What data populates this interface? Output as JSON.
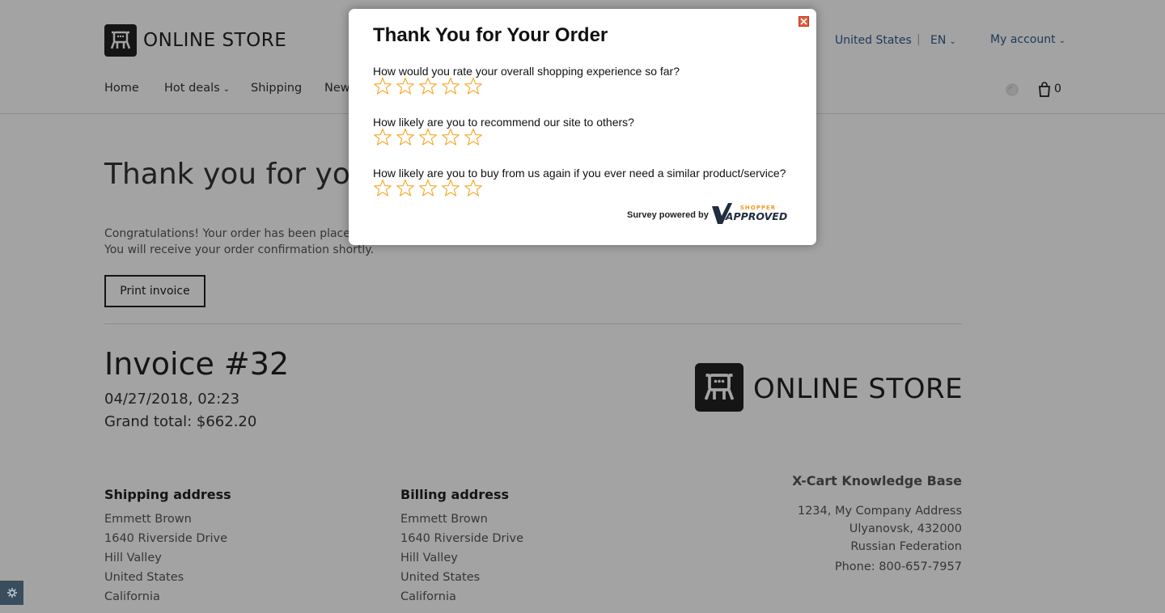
{
  "header": {
    "brand": "ONLINE STORE",
    "country": "United States",
    "separator": "|",
    "language": "EN",
    "account": "My account",
    "cart_count": "0",
    "nav": [
      "Home",
      "Hot deals",
      "Shipping",
      "New"
    ]
  },
  "page": {
    "heading": "Thank you for your order",
    "congrats_line1": "Congratulations! Your order has been placed.",
    "congrats_line2": "You will receive your order confirmation shortly.",
    "print_button": "Print invoice"
  },
  "invoice": {
    "title": "Invoice #32",
    "date": "04/27/2018, 02:23",
    "grand_total": "Grand total: $662.20",
    "brand": "ONLINE STORE",
    "shipping": {
      "title": "Shipping address",
      "lines": [
        "Emmett  Brown",
        "1640 Riverside Drive",
        "Hill Valley",
        "United States",
        "California"
      ]
    },
    "billing": {
      "title": "Billing address",
      "lines": [
        "Emmett  Brown",
        "1640 Riverside Drive",
        "Hill Valley",
        "United States",
        "California"
      ]
    },
    "company": {
      "name": "X-Cart Knowledge Base",
      "lines": [
        "1234, My Company Address",
        "Ulyanovsk, 432000",
        "Russian Federation",
        "Phone: 800-657-7957"
      ]
    }
  },
  "survey": {
    "title": "Thank You for Your Order",
    "questions": [
      {
        "text": "How would you rate your overall shopping experience so far?",
        "rating": 0,
        "max": 5
      },
      {
        "text": "How likely are you to recommend our site to others?",
        "rating": 0,
        "max": 5
      },
      {
        "text": "How likely are you to buy from us again if you ever need a similar product/service?",
        "rating": 0,
        "max": 5
      }
    ],
    "powered_by": "Survey powered by",
    "provider_logo_text": [
      "SHOPPER",
      "APPROVED"
    ]
  },
  "colors": {
    "link": "#2f5a8f",
    "star": "#f5a623",
    "close": "#e8583a",
    "overlay": "rgba(0,0,0,0.36)"
  },
  "icons": [
    "store-logo-icon",
    "search-icon",
    "cart-icon",
    "settings-icon",
    "close-icon",
    "star-icon",
    "shopper-approved-logo"
  ]
}
